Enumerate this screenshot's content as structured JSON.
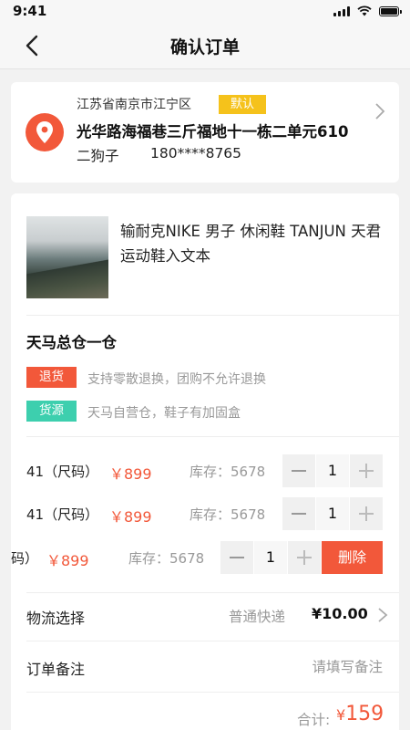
{
  "status_bar": {
    "time": "9:41"
  },
  "nav": {
    "title": "确认订单"
  },
  "address": {
    "region": "江苏省南京市江宁区",
    "default_tag": "默认",
    "detail": "光华路海福巷三斤福地十一栋二单元610",
    "name": "二狗子",
    "phone": "180****8765"
  },
  "product": {
    "name": "输耐克NIKE 男子 休闲鞋 TANJUN 天君运动鞋入文本"
  },
  "warehouse": {
    "name": "天马总仓一仓",
    "tags": [
      {
        "label": "退货",
        "text": "支持零散退换，团购不允许退换"
      },
      {
        "label": "货源",
        "text": "天马自营仓，鞋子有加固盒"
      }
    ]
  },
  "skus": [
    {
      "size": "41（尺码）",
      "price": "￥899",
      "stock": "库存：5678",
      "qty": "1"
    },
    {
      "size": "41（尺码）",
      "price": "￥899",
      "stock": "库存：5678",
      "qty": "1"
    },
    {
      "size": "码）",
      "price": "￥899",
      "stock": "库存：5678",
      "qty": "1",
      "delete_label": "删除"
    }
  ],
  "shipping": {
    "label": "物流选择",
    "method": "普通快递",
    "price": "¥10.00"
  },
  "remark": {
    "label": "订单备注",
    "placeholder": "请填写备注"
  },
  "total": {
    "label": "合计:",
    "currency": "¥",
    "amount": "159"
  },
  "colors": {
    "accent": "#f2583a",
    "default_tag": "#f5c21b",
    "source_tag": "#3dcfae"
  }
}
